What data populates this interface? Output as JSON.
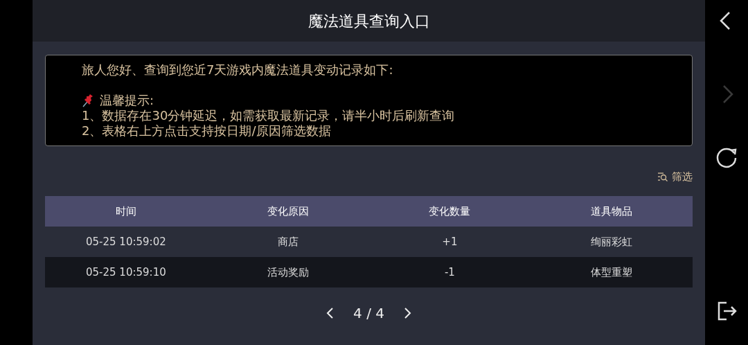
{
  "title": "魔法道具查询入口",
  "notice": {
    "greeting": "旅人您好、查询到您近7天游戏内魔法道具变动记录如下:",
    "tips_title": "温馨提示:",
    "tips": [
      "1、数据存在30分钟延迟，如需获取最新记录，请半小时后刷新查询",
      "2、表格右上方点击支持按日期/原因筛选数据"
    ]
  },
  "filter": {
    "label": "筛选"
  },
  "table": {
    "columns": [
      "时间",
      "变化原因",
      "变化数量",
      "道具物品"
    ],
    "rows": [
      [
        "05-25 10:59:02",
        "商店",
        "+1",
        "绚丽彩虹"
      ],
      [
        "05-25 10:59:10",
        "活动奖励",
        "-1",
        "体型重塑"
      ]
    ]
  },
  "pagination": {
    "page": "4 / 4"
  },
  "side_nav": [
    {
      "kind": "back",
      "disabled": false
    },
    {
      "kind": "forward",
      "disabled": true
    },
    {
      "kind": "refresh",
      "disabled": false
    },
    {
      "kind": "exit",
      "disabled": false
    }
  ]
}
